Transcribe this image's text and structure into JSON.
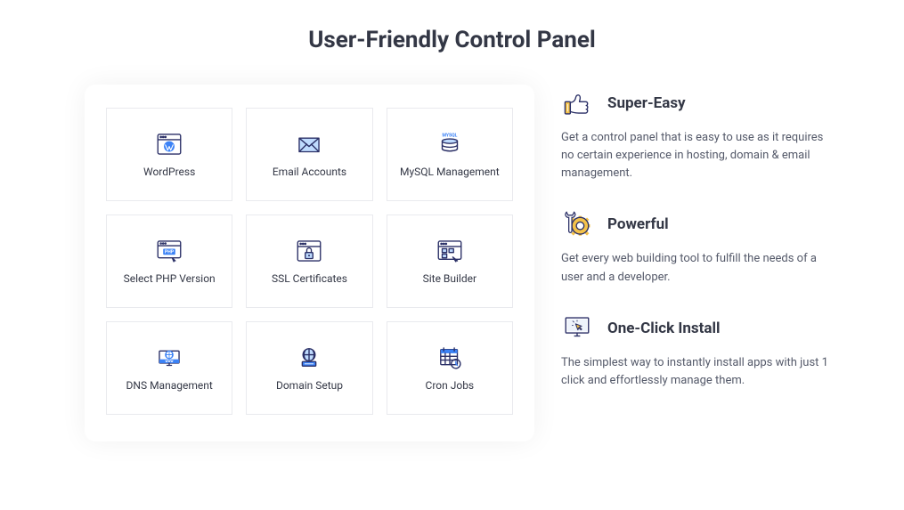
{
  "title": "User-Friendly Control Panel",
  "tiles": [
    {
      "label": "WordPress"
    },
    {
      "label": "Email Accounts"
    },
    {
      "label": "MySQL Management"
    },
    {
      "label": "Select PHP Version"
    },
    {
      "label": "SSL Certificates"
    },
    {
      "label": "Site Builder"
    },
    {
      "label": "DNS Management"
    },
    {
      "label": "Domain Setup"
    },
    {
      "label": "Cron Jobs"
    }
  ],
  "features": [
    {
      "title": "Super-Easy",
      "desc": "Get a control panel that is easy to use as it requires no certain experience in hosting, domain & email management."
    },
    {
      "title": "Powerful",
      "desc": "Get every web building tool to fulfill the needs of a user and a developer."
    },
    {
      "title": "One-Click Install",
      "desc": "The simplest way to instantly install apps with just 1 click and effortlessly manage them."
    }
  ],
  "icons": {
    "mysql_badge": "MYSQL",
    "php_badge": "PHP",
    "www_badge": "WWW"
  }
}
